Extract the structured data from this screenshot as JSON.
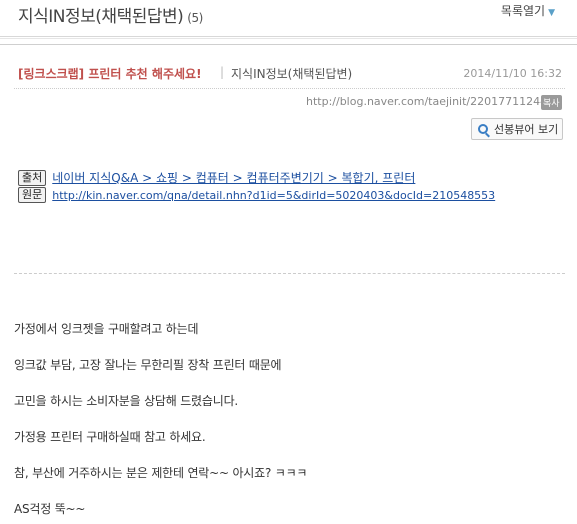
{
  "header": {
    "category_title": "지식IN정보(채택된답변)",
    "category_count": "(5)",
    "list_toggle_label": "목록열기"
  },
  "post": {
    "title": "[링크스크랩] 프린터 추천 해주세요!",
    "category": "지식IN정보(채택된답변)",
    "date": "2014/11/10 16:32",
    "url": "http://blog.naver.com/taejinit/220177112445",
    "copy_badge": "복사",
    "neighbor_button_label": "선봉뷰어 보기"
  },
  "source": {
    "source_tag": "출처",
    "source_path": "네이버 지식Q&A > 쇼핑 > 컴퓨터 > 컴퓨터주변기기 > 복합기, 프린터",
    "origin_tag": "원문",
    "origin_url": "http://kin.naver.com/qna/detail.nhn?d1id=5&dirId=5020403&docId=210548553"
  },
  "body": {
    "lines": [
      "가정에서 잉크젯을 구매할려고 하는데",
      "잉크값 부담, 고장 잘나는 무한리필 장착 프린터 때문에",
      "고민을 하시는 소비자분을 상담해 드렸습니다.",
      "가정용 프린터 구매하실때 참고 하세요.",
      "참, 부산에 거주하시는 분은 제한테 연락~~  아시죠? ㅋㅋㅋ",
      "AS걱정 뚝~~"
    ]
  },
  "colors": {
    "title_red": "#c0504d",
    "link_blue": "#1c4fa0",
    "icon_blue": "#3a7ec4"
  }
}
